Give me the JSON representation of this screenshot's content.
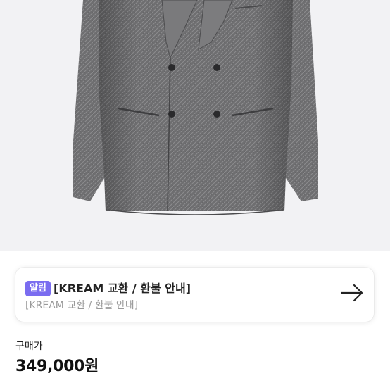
{
  "product": {
    "image_alt": "gray herringbone double-breasted wool coat"
  },
  "notice": {
    "badge": "알림",
    "title": "[KREAM 교환 / 환불 안내]",
    "subtitle": "[KREAM 교환 / 환불 안내]",
    "arrow_icon": "arrow-right-icon"
  },
  "price": {
    "label": "구매가",
    "value": "349,000원"
  },
  "colors": {
    "badge": "#7a6cf0",
    "hero_background": "#f2f2f4"
  }
}
